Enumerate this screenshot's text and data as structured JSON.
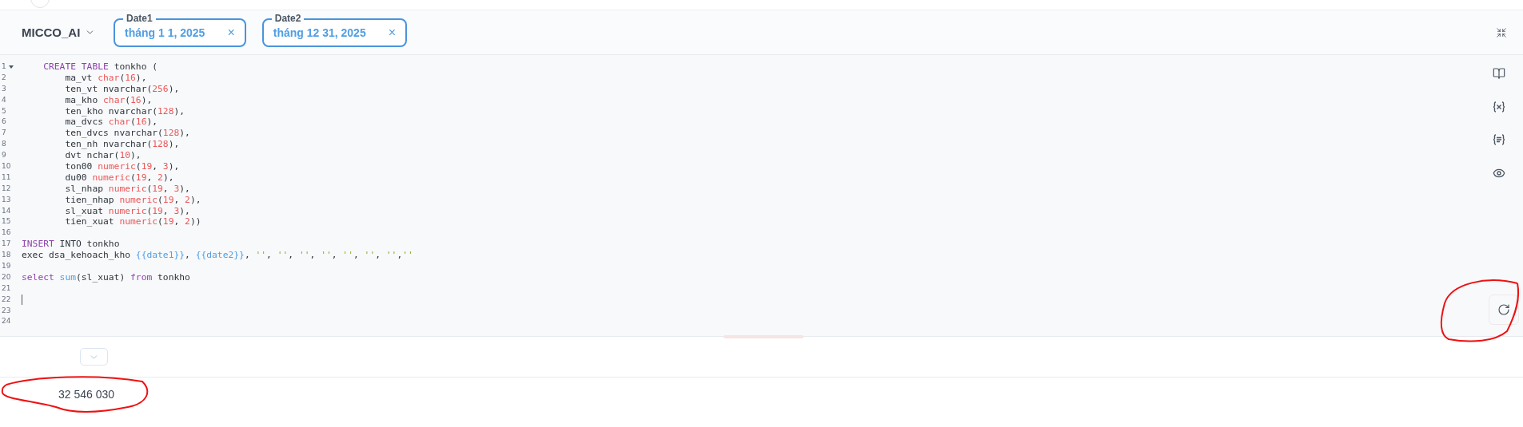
{
  "toolbar": {
    "database": "MICCO_AI",
    "filters": [
      {
        "label": "Date1",
        "value": "tháng 1 1, 2025",
        "clear": "×"
      },
      {
        "label": "Date2",
        "value": "tháng 12 31, 2025",
        "clear": "×"
      }
    ]
  },
  "editor": {
    "lines": [
      {
        "number": "1",
        "foldable": true,
        "tokens": [
          {
            "kind": "keyword",
            "text": "    CREATE TABLE"
          },
          {
            "kind": "plain",
            "text": " tonkho ("
          }
        ]
      },
      {
        "number": "2",
        "tokens": [
          {
            "kind": "plain",
            "text": "        ma_vt "
          },
          {
            "kind": "type",
            "text": "char"
          },
          {
            "kind": "plain",
            "text": "("
          },
          {
            "kind": "number",
            "text": "16"
          },
          {
            "kind": "plain",
            "text": "),"
          }
        ]
      },
      {
        "number": "3",
        "tokens": [
          {
            "kind": "plain",
            "text": "        ten_vt nvarchar("
          },
          {
            "kind": "number",
            "text": "256"
          },
          {
            "kind": "plain",
            "text": "),"
          }
        ]
      },
      {
        "number": "4",
        "tokens": [
          {
            "kind": "plain",
            "text": "        ma_kho "
          },
          {
            "kind": "type",
            "text": "char"
          },
          {
            "kind": "plain",
            "text": "("
          },
          {
            "kind": "number",
            "text": "16"
          },
          {
            "kind": "plain",
            "text": "),"
          }
        ]
      },
      {
        "number": "5",
        "tokens": [
          {
            "kind": "plain",
            "text": "        ten_kho nvarchar("
          },
          {
            "kind": "number",
            "text": "128"
          },
          {
            "kind": "plain",
            "text": "),"
          }
        ]
      },
      {
        "number": "6",
        "tokens": [
          {
            "kind": "plain",
            "text": "        ma_dvcs "
          },
          {
            "kind": "type",
            "text": "char"
          },
          {
            "kind": "plain",
            "text": "("
          },
          {
            "kind": "number",
            "text": "16"
          },
          {
            "kind": "plain",
            "text": "),"
          }
        ]
      },
      {
        "number": "7",
        "tokens": [
          {
            "kind": "plain",
            "text": "        ten_dvcs nvarchar("
          },
          {
            "kind": "number",
            "text": "128"
          },
          {
            "kind": "plain",
            "text": "),"
          }
        ]
      },
      {
        "number": "8",
        "tokens": [
          {
            "kind": "plain",
            "text": "        ten_nh nvarchar("
          },
          {
            "kind": "number",
            "text": "128"
          },
          {
            "kind": "plain",
            "text": "),"
          }
        ]
      },
      {
        "number": "9",
        "tokens": [
          {
            "kind": "plain",
            "text": "        dvt nchar("
          },
          {
            "kind": "number",
            "text": "10"
          },
          {
            "kind": "plain",
            "text": "),"
          }
        ]
      },
      {
        "number": "10",
        "tokens": [
          {
            "kind": "plain",
            "text": "        ton00 "
          },
          {
            "kind": "type",
            "text": "numeric"
          },
          {
            "kind": "plain",
            "text": "("
          },
          {
            "kind": "number",
            "text": "19"
          },
          {
            "kind": "plain",
            "text": ", "
          },
          {
            "kind": "number",
            "text": "3"
          },
          {
            "kind": "plain",
            "text": "),"
          }
        ]
      },
      {
        "number": "11",
        "tokens": [
          {
            "kind": "plain",
            "text": "        du00 "
          },
          {
            "kind": "type",
            "text": "numeric"
          },
          {
            "kind": "plain",
            "text": "("
          },
          {
            "kind": "number",
            "text": "19"
          },
          {
            "kind": "plain",
            "text": ", "
          },
          {
            "kind": "number",
            "text": "2"
          },
          {
            "kind": "plain",
            "text": "),"
          }
        ]
      },
      {
        "number": "12",
        "tokens": [
          {
            "kind": "plain",
            "text": "        sl_nhap "
          },
          {
            "kind": "type",
            "text": "numeric"
          },
          {
            "kind": "plain",
            "text": "("
          },
          {
            "kind": "number",
            "text": "19"
          },
          {
            "kind": "plain",
            "text": ", "
          },
          {
            "kind": "number",
            "text": "3"
          },
          {
            "kind": "plain",
            "text": "),"
          }
        ]
      },
      {
        "number": "13",
        "tokens": [
          {
            "kind": "plain",
            "text": "        tien_nhap "
          },
          {
            "kind": "type",
            "text": "numeric"
          },
          {
            "kind": "plain",
            "text": "("
          },
          {
            "kind": "number",
            "text": "19"
          },
          {
            "kind": "plain",
            "text": ", "
          },
          {
            "kind": "number",
            "text": "2"
          },
          {
            "kind": "plain",
            "text": "),"
          }
        ]
      },
      {
        "number": "14",
        "tokens": [
          {
            "kind": "plain",
            "text": "        sl_xuat "
          },
          {
            "kind": "type",
            "text": "numeric"
          },
          {
            "kind": "plain",
            "text": "("
          },
          {
            "kind": "number",
            "text": "19"
          },
          {
            "kind": "plain",
            "text": ", "
          },
          {
            "kind": "number",
            "text": "3"
          },
          {
            "kind": "plain",
            "text": "),"
          }
        ]
      },
      {
        "number": "15",
        "tokens": [
          {
            "kind": "plain",
            "text": "        tien_xuat "
          },
          {
            "kind": "type",
            "text": "numeric"
          },
          {
            "kind": "plain",
            "text": "("
          },
          {
            "kind": "number",
            "text": "19"
          },
          {
            "kind": "plain",
            "text": ", "
          },
          {
            "kind": "number",
            "text": "2"
          },
          {
            "kind": "plain",
            "text": "))"
          }
        ]
      },
      {
        "number": "16"
      },
      {
        "number": "17",
        "tokens": [
          {
            "kind": "keyword",
            "text": "INSERT"
          },
          {
            "kind": "plain",
            "text": " INTO tonkho"
          }
        ]
      },
      {
        "number": "18",
        "tokens": [
          {
            "kind": "plain",
            "text": "exec dsa_kehoach_kho "
          },
          {
            "kind": "variable",
            "text": "{{date1}}"
          },
          {
            "kind": "plain",
            "text": ", "
          },
          {
            "kind": "variable",
            "text": "{{date2}}"
          },
          {
            "kind": "plain",
            "text": ", "
          },
          {
            "kind": "string",
            "text": "''"
          },
          {
            "kind": "plain",
            "text": ", "
          },
          {
            "kind": "string",
            "text": "''"
          },
          {
            "kind": "plain",
            "text": ", "
          },
          {
            "kind": "string",
            "text": "''"
          },
          {
            "kind": "plain",
            "text": ", "
          },
          {
            "kind": "string",
            "text": "''"
          },
          {
            "kind": "plain",
            "text": ", "
          },
          {
            "kind": "string",
            "text": "''"
          },
          {
            "kind": "plain",
            "text": ", "
          },
          {
            "kind": "string",
            "text": "''"
          },
          {
            "kind": "plain",
            "text": ", "
          },
          {
            "kind": "string",
            "text": "''"
          },
          {
            "kind": "plain",
            "text": ","
          },
          {
            "kind": "string",
            "text": "''"
          }
        ]
      },
      {
        "number": "19"
      },
      {
        "number": "20",
        "tokens": [
          {
            "kind": "keyword",
            "text": "select "
          },
          {
            "kind": "function",
            "text": "sum"
          },
          {
            "kind": "plain",
            "text": "(sl_xuat) "
          },
          {
            "kind": "keyword",
            "text": "from"
          },
          {
            "kind": "plain",
            "text": " tonkho"
          }
        ]
      },
      {
        "number": "21"
      },
      {
        "number": "22",
        "cursor": true
      },
      {
        "number": "23"
      },
      {
        "number": "24"
      }
    ]
  },
  "result": {
    "value": "32 546 030"
  }
}
